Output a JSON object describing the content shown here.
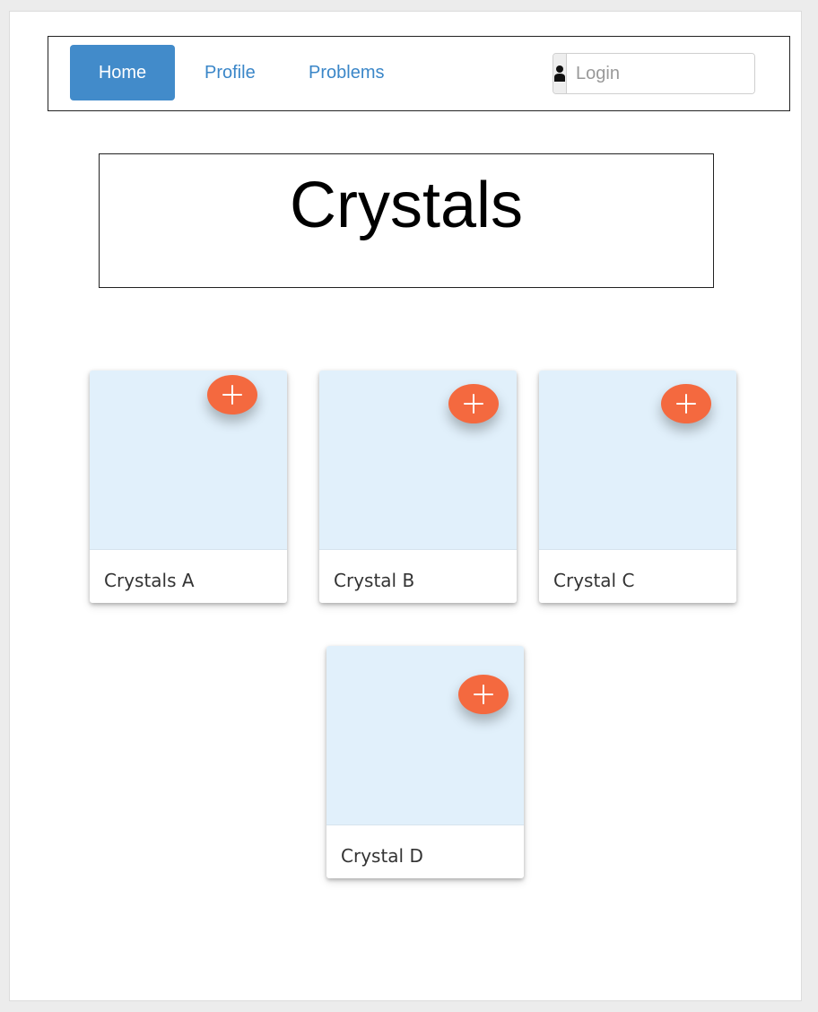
{
  "nav": {
    "items": [
      {
        "label": "Home"
      },
      {
        "label": "Profile"
      },
      {
        "label": "Problems"
      }
    ],
    "login": {
      "placeholder": "Login",
      "icon": "user-icon"
    }
  },
  "page": {
    "title": "Crystals"
  },
  "cards": [
    {
      "title": "Crystals A",
      "action_icon": "plus-icon"
    },
    {
      "title": "Crystal B",
      "action_icon": "plus-icon"
    },
    {
      "title": "Crystal C",
      "action_icon": "plus-icon"
    },
    {
      "title": "Crystal D",
      "action_icon": "plus-icon"
    }
  ],
  "colors": {
    "nav_active_bg": "#428bca",
    "nav_link": "#3a86c8",
    "card_media_bg": "#e1f0fb",
    "fab_bg": "#f4693f"
  }
}
